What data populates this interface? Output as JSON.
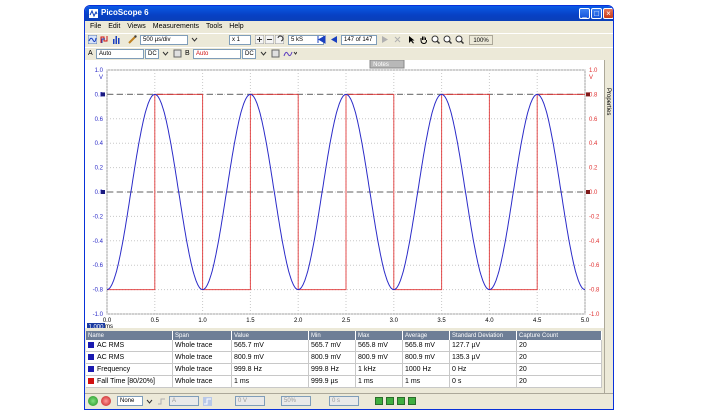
{
  "window": {
    "title": "PicoScope 6"
  },
  "menu": [
    "File",
    "Edit",
    "Views",
    "Measurements",
    "Tools",
    "Help"
  ],
  "toolbar1": {
    "timebase": "500 µs/div",
    "zoom": "x 1",
    "samples": "5 kS",
    "buffer": "147 of 147",
    "zoom_percent": "100%"
  },
  "toolbar2": {
    "chA_label": "A",
    "chA_range": "Auto",
    "chA_coupling": "DC",
    "chB_label": "B",
    "chB_range": "Auto",
    "chB_coupling": "DC"
  },
  "plot": {
    "notes_label": "Notes",
    "left_unit": "V",
    "right_unit": "V",
    "x_unit": "ms",
    "y_ticks": [
      "1.0",
      "0.8",
      "0.6",
      "0.4",
      "0.2",
      "0.0",
      "-0.2",
      "-0.4",
      "-0.6",
      "-0.8",
      "-1.0"
    ],
    "x_ticks": [
      "0.0",
      "0.5",
      "1.0",
      "1.5",
      "2.0",
      "2.5",
      "3.0",
      "3.5",
      "4.0",
      "4.5",
      "5.0"
    ],
    "axis_badge": "1.000",
    "colors": {
      "chA": "#2b2bc8",
      "chB": "#e03030",
      "grid": "#c8c8c8",
      "ruler": "#808080"
    }
  },
  "chart_data": {
    "type": "line",
    "xlabel": "ms",
    "ylabel": "V",
    "xlim": [
      0,
      5
    ],
    "ylim": [
      -1,
      1
    ],
    "grid": true,
    "series": [
      {
        "shape": "sine",
        "channel": "A",
        "frequency_hz": 1000,
        "amplitude_v": 0.8,
        "color": "#2b2bc8"
      },
      {
        "shape": "square",
        "channel": "B",
        "frequency_hz": 1000,
        "amplitude_v": 0.8,
        "color": "#e03030"
      }
    ],
    "rulers_v": [
      0.8,
      0.0
    ]
  },
  "measurements": {
    "headers": [
      "Name",
      "Span",
      "Value",
      "Min",
      "Max",
      "Average",
      "Standard Deviation",
      "Capture Count"
    ],
    "rows": [
      {
        "color": "#1a1ab0",
        "name": "AC RMS",
        "span": "Whole trace",
        "value": "565.7 mV",
        "min": "565.7 mV",
        "max": "565.8 mV",
        "avg": "565.8 mV",
        "std": "127.7 µV",
        "count": "20"
      },
      {
        "color": "#1a1ab0",
        "name": "AC RMS",
        "span": "Whole trace",
        "value": "800.9 mV",
        "min": "800.9 mV",
        "max": "800.9 mV",
        "avg": "800.9 mV",
        "std": "135.3 µV",
        "count": "20"
      },
      {
        "color": "#1a1ab0",
        "name": "Frequency",
        "span": "Whole trace",
        "value": "999.8 Hz",
        "min": "999.8 Hz",
        "max": "1 kHz",
        "avg": "1000 Hz",
        "std": "0 Hz",
        "count": "20"
      },
      {
        "color": "#d01010",
        "name": "Fall Time [80/20%]",
        "span": "Whole trace",
        "value": "1 ms",
        "min": "999.9 µs",
        "max": "1 ms",
        "avg": "1 ms",
        "std": "0 s",
        "count": "20"
      }
    ]
  },
  "status": {
    "trigger_mode": "None",
    "channel": "A",
    "level": "0 V",
    "pretrigger": "50%",
    "delay": "0 s"
  },
  "sidetab": "Properties"
}
